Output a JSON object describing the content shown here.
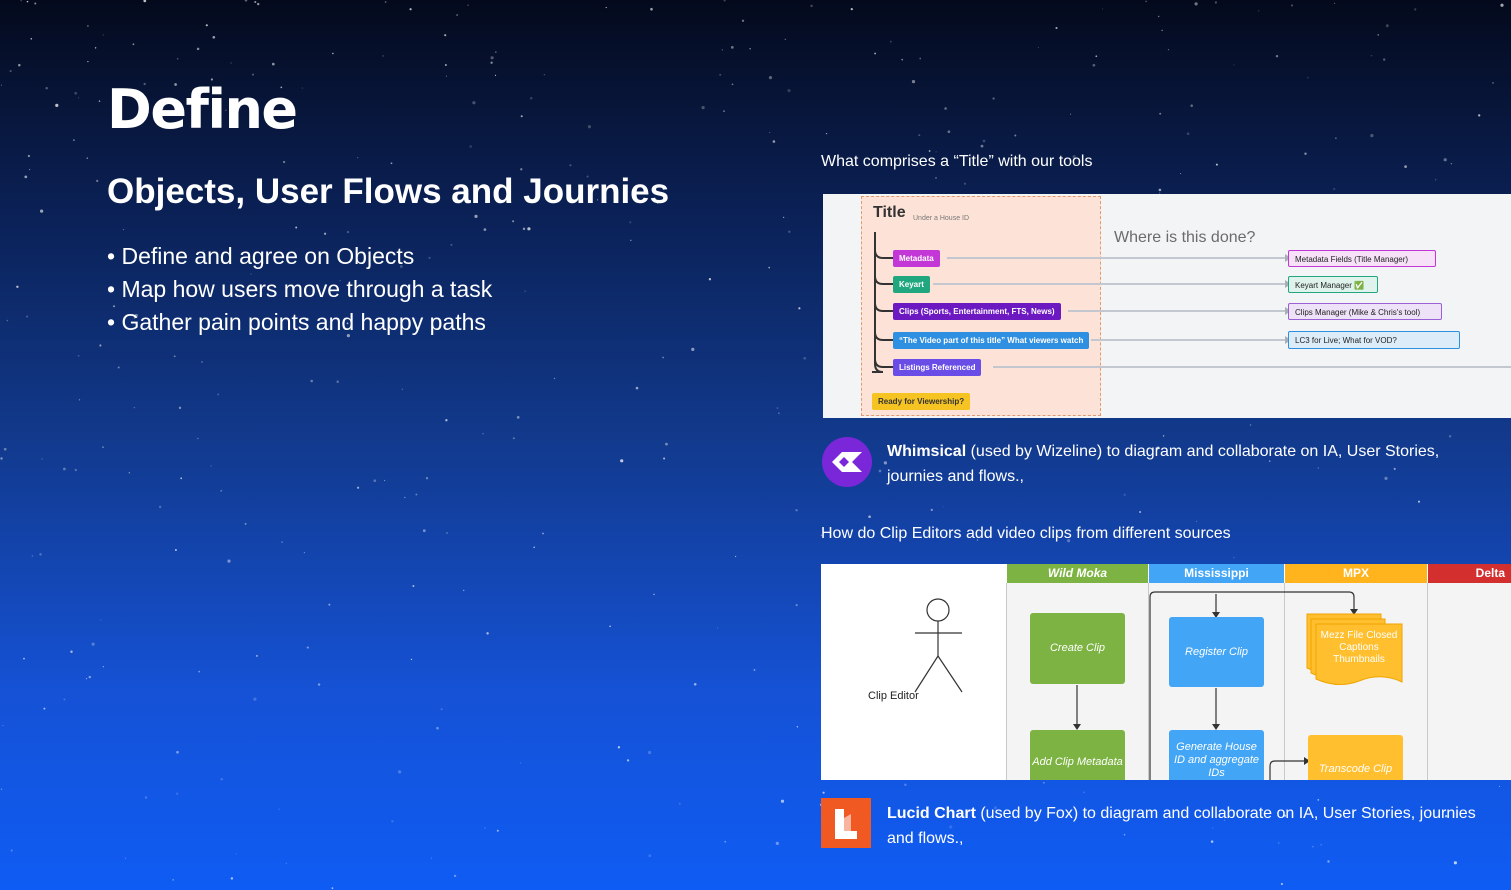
{
  "slide": {
    "heading": "Define",
    "subheading": "Objects, User Flows and Journies",
    "bullets": [
      "Define and agree on Objects",
      "Map how users move through a task",
      "Gather pain points and happy paths"
    ]
  },
  "panel1": {
    "caption": "What comprises a “Title” with our tools",
    "diagram": {
      "title": "Title",
      "subtitle": "Under a House ID",
      "question": "Where is this done?",
      "tags": [
        {
          "label": "Metadata",
          "color": "#c337d6"
        },
        {
          "label": "Keyart",
          "color": "#21a77f"
        },
        {
          "label": "Clips (Sports, Entertainment, FTS, News)",
          "color": "#6d19c2"
        },
        {
          "label": "“The Video part of this title” What viewers watch",
          "color": "#2f8fe0"
        },
        {
          "label": "Listings Referenced",
          "color": "#6a4de6"
        },
        {
          "label": "Ready for Viewership?",
          "color": "#f5c322"
        }
      ],
      "targets": [
        {
          "label": "Metadata Fields (Title Manager)",
          "color": "#c337d6",
          "bg": "#f6e1f8"
        },
        {
          "label": "Keyart Manager ✅",
          "color": "#21a77f",
          "bg": "#dff3ec"
        },
        {
          "label": "Clips Manager (Mike & Chris's tool)",
          "color": "#9b5fd6",
          "bg": "#eee2f8"
        },
        {
          "label": "LC3 for Live; What for VOD?",
          "color": "#2f8fe0",
          "bg": "#dcecf9"
        }
      ]
    }
  },
  "whimsical": {
    "name": "Whimsical",
    "desc": " (used by Wizeline) to diagram and collaborate on IA, User Stories, journies and flows.,",
    "brand_color": "#7a27d9",
    "icon": "whimsical-logo-icon"
  },
  "panel2": {
    "caption": "How do Clip Editors add video clips from different sources",
    "diagram": {
      "actor": "Clip Editor",
      "lanes": [
        {
          "label": "Wild Moka",
          "color": "#7cb342"
        },
        {
          "label": "Mississippi",
          "color": "#42a5f5"
        },
        {
          "label": "MPX",
          "color": "#ffb41e"
        },
        {
          "label": "Delta",
          "color": "#d32f2f"
        }
      ],
      "boxes": {
        "create_clip": "Create Clip",
        "add_clip_metadata": "Add  Clip Metadata",
        "register_clip": "Register Clip",
        "generate_house_id": "Generate House ID and aggregate IDs",
        "mezz_docs": "Mezz File Closed Captions Thumbnails",
        "transcode_clip": "Transcode Clip"
      }
    }
  },
  "lucid": {
    "name": "Lucid Chart",
    "desc": " (used by Fox) to diagram and collaborate on IA, User Stories, journies and flows.,",
    "brand_color": "#f05a22",
    "icon": "lucidchart-logo-icon"
  }
}
